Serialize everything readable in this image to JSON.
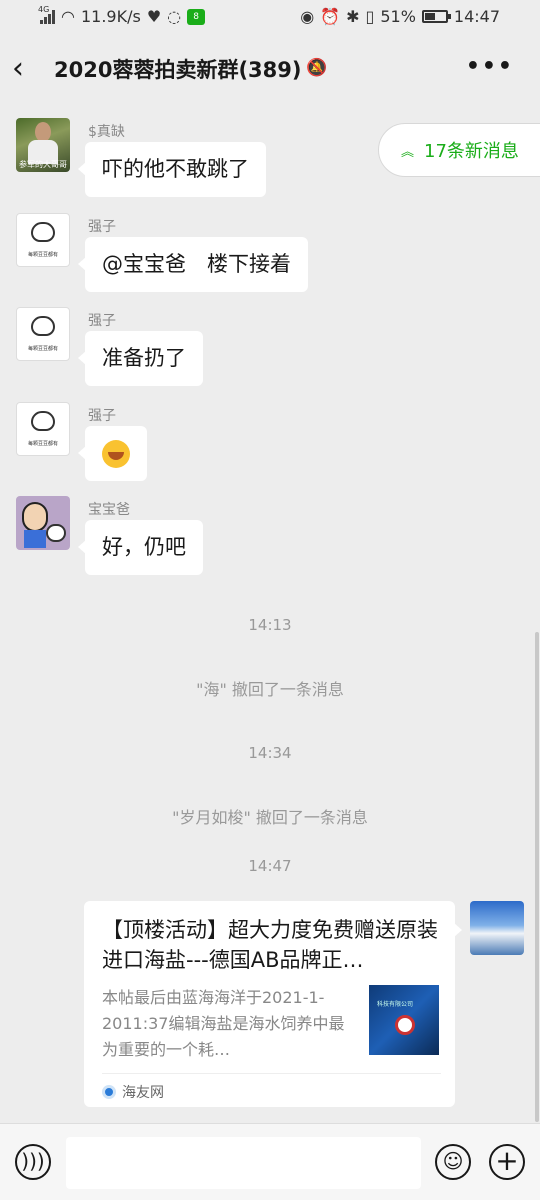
{
  "status_bar": {
    "network": "4G",
    "speed": "11.9K/s",
    "battery_percent": "51%",
    "battery_level": 0.51,
    "time": "14:47",
    "app_badge": "8"
  },
  "header": {
    "title": "2020蓉蓉拍卖新群(389)",
    "back_icon": "chevron-left-icon",
    "more_icon": "more-dots-icon",
    "more_label": "•••"
  },
  "new_messages": {
    "label": "17条新消息",
    "icon": "double-chevron-up-icon"
  },
  "messages": [
    {
      "sender": "$真缺",
      "text": "吓的他不敢跳了",
      "avatar_caption": "参军的大哥哥"
    },
    {
      "sender": "强子",
      "text": "@宝宝爸　楼下接着",
      "avatar_caption": "每颗豆豆都有"
    },
    {
      "sender": "强子",
      "text": "准备扔了",
      "avatar_caption": "每颗豆豆都有"
    },
    {
      "sender": "强子",
      "text": "",
      "emoji": "face-with-tears-emoji",
      "avatar_caption": "每颗豆豆都有"
    },
    {
      "sender": "宝宝爸",
      "text": "好，仍吧"
    }
  ],
  "system_events": [
    {
      "time": "14:13",
      "notice": "\"海\" 撤回了一条消息"
    },
    {
      "time": "14:34",
      "notice": "\"岁月如梭\" 撤回了一条消息"
    },
    {
      "time": "14:47"
    }
  ],
  "link_card": {
    "title": "【顶楼活动】超大力度免费赠送原装进口海盐---德国AB品牌正…",
    "description": "本帖最后由蓝海海洋于2021-1-2011:37编辑海盐是海水饲养中最为重要的一个耗…",
    "thumb_label": "科技有限公司",
    "source": "海友网"
  },
  "input_bar": {
    "voice_icon": "voice-icon",
    "emoji_icon": "emoji-icon",
    "plus_icon": "plus-icon",
    "placeholder": ""
  }
}
